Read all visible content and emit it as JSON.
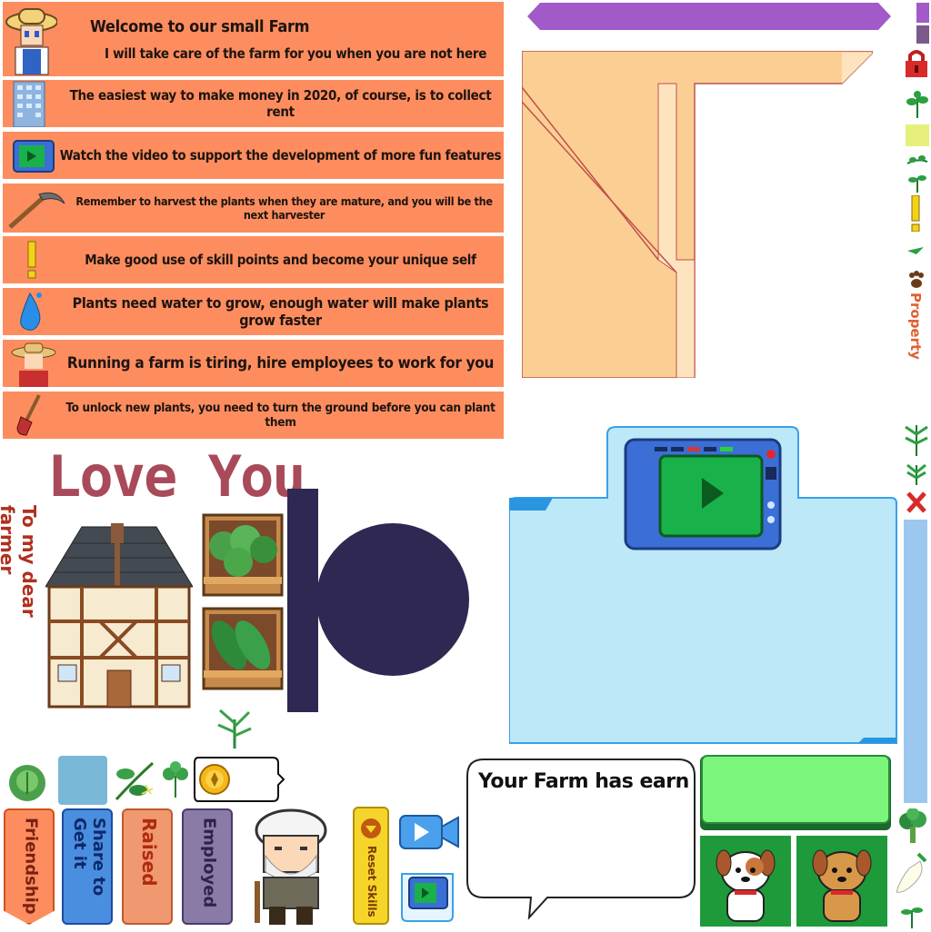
{
  "tips": [
    {
      "line1": "Welcome to our small Farm",
      "line2": "I will take care of the farm for you when you are not here",
      "icon": "farmer-girl-icon"
    },
    {
      "text": "The easiest way to make money in 2020, of course, is to collect rent",
      "icon": "building-icon"
    },
    {
      "text": "Watch the video to support the development of more fun features",
      "icon": "tv-icon"
    },
    {
      "text": "Remember to harvest the plants when they are mature, and you will be the next harvester",
      "icon": "sickle-icon"
    },
    {
      "text": "Make good use of skill points and become your unique self",
      "icon": "exclamation-icon"
    },
    {
      "text": "Plants need water to grow, enough water will make plants grow faster",
      "icon": "water-drop-icon"
    },
    {
      "text": "Running a farm is tiring, hire employees to work for you",
      "icon": "farmer-boy-icon"
    },
    {
      "text": "To unlock new plants, you need to turn the ground before you can plant them",
      "icon": "shovel-icon"
    }
  ],
  "love_title": "Love You",
  "dear_farmer": "To my dear farmer",
  "property_label": "Property",
  "earn_title": "Your Farm has earn",
  "tabs": {
    "friendship": "Friendship",
    "share": "Share to Get it",
    "raised": "Raised",
    "employed": "Employed"
  },
  "reset_skills": "Reset Skills",
  "colors": {
    "banner": "#fd8d5f",
    "purple_bar": "#a25ac8",
    "love": "#a84a5a",
    "navy": "#2e2852",
    "panel_blue": "#bce8f8",
    "green_bar": "#7cf57c",
    "dog_bg": "#1f9a3a"
  }
}
